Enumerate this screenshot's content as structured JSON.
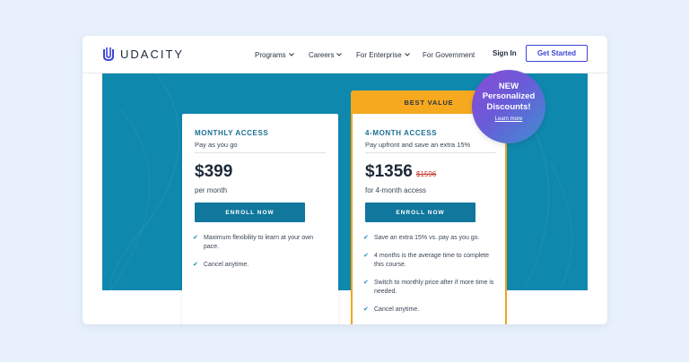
{
  "brand": {
    "name": "UDACITY"
  },
  "nav": {
    "items": [
      {
        "label": "Programs",
        "has_dropdown": true
      },
      {
        "label": "Careers",
        "has_dropdown": true
      },
      {
        "label": "For Enterprise",
        "has_dropdown": true
      },
      {
        "label": "For Government",
        "has_dropdown": false
      }
    ],
    "sign_in": "Sign In",
    "get_started": "Get Started"
  },
  "plans": [
    {
      "title": "MONTHLY ACCESS",
      "subtitle": "Pay as you go",
      "price": "$399",
      "period": "per month",
      "cta": "ENROLL NOW",
      "features": [
        "Maximum flexibility to learn at your own pace.",
        "Cancel anytime."
      ]
    },
    {
      "ribbon": "BEST VALUE",
      "title": "4-MONTH ACCESS",
      "subtitle": "Pay upfront and save an extra 15%",
      "price": "$1356",
      "old_price": "$1596",
      "period": "for 4-month access",
      "cta": "ENROLL NOW",
      "features": [
        "Save an extra 15% vs. pay as you go.",
        "4 months is the average time to complete this course.",
        "Switch to monthly price after if more time is needed.",
        "Cancel anytime."
      ]
    }
  ],
  "badge": {
    "new": "NEW",
    "line1": "Personalized",
    "line2": "Discounts!",
    "link": "Learn more"
  },
  "colors": {
    "hero": "#0f88ae",
    "accent": "#3b45d6",
    "ribbon": "#f6a91f",
    "button": "#11779d"
  },
  "icons": {
    "check": "check-icon",
    "chevron": "chevron-down-icon",
    "logo": "udacity-logo-icon"
  }
}
